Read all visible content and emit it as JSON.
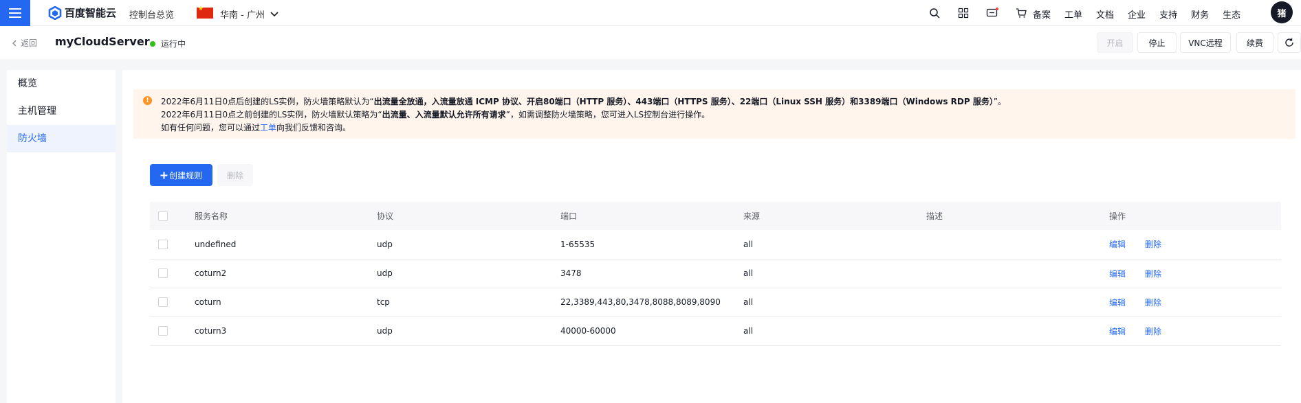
{
  "topbar": {
    "brand": "百度智能云",
    "console": "控制台总览",
    "region": "华南 - 广州",
    "nav": [
      "备案",
      "工单",
      "文档",
      "企业",
      "支持",
      "财务",
      "生态"
    ],
    "avatar": "猪"
  },
  "header": {
    "back": "返回",
    "title": "myCloudServer",
    "status": "运行中",
    "buttons": [
      "开启",
      "停止",
      "VNC远程",
      "续费"
    ]
  },
  "sidebar": {
    "items": [
      "概览",
      "主机管理",
      "防火墙"
    ]
  },
  "alert": {
    "line1_pre": "2022年6月11日0点后创建的LS实例，防火墙策略默认为“",
    "line1_bold": "出流量全放通，入流量放通 ICMP 协议、开启80端口（HTTP 服务）、443端口（HTTPS 服务）、22端口（Linux SSH 服务）和3389端口（Windows RDP 服务）",
    "line1_post": "”。",
    "line2_pre": "2022年6月11日0点之前创建的LS实例，防火墙默认策略为“",
    "line2_bold": "出流量、入流量默认允许所有请求",
    "line2_post": "”，如需调整防火墙策略，您可进入LS控制台进行操作。",
    "line3_pre": "如有任何问题，您可以通过",
    "line3_link": "工单",
    "line3_post": "向我们反馈和咨询。"
  },
  "toolbar": {
    "create": "创建规则",
    "delete": "删除"
  },
  "table": {
    "headers": [
      "服务名称",
      "协议",
      "端口",
      "来源",
      "描述",
      "操作"
    ],
    "rows": [
      {
        "name": "undefined",
        "protocol": "udp",
        "port": "1-65535",
        "source": "all",
        "desc": ""
      },
      {
        "name": "coturn2",
        "protocol": "udp",
        "port": "3478",
        "source": "all",
        "desc": ""
      },
      {
        "name": "coturn",
        "protocol": "tcp",
        "port": "22,3389,443,80,3478,8088,8089,8090",
        "source": "all",
        "desc": ""
      },
      {
        "name": "coturn3",
        "protocol": "udp",
        "port": "40000-60000",
        "source": "all",
        "desc": ""
      }
    ],
    "op_edit": "编辑",
    "op_delete": "删除"
  },
  "colors": {
    "accent": "#2468f2",
    "warning": "#ff9326",
    "running": "#30bf13"
  }
}
